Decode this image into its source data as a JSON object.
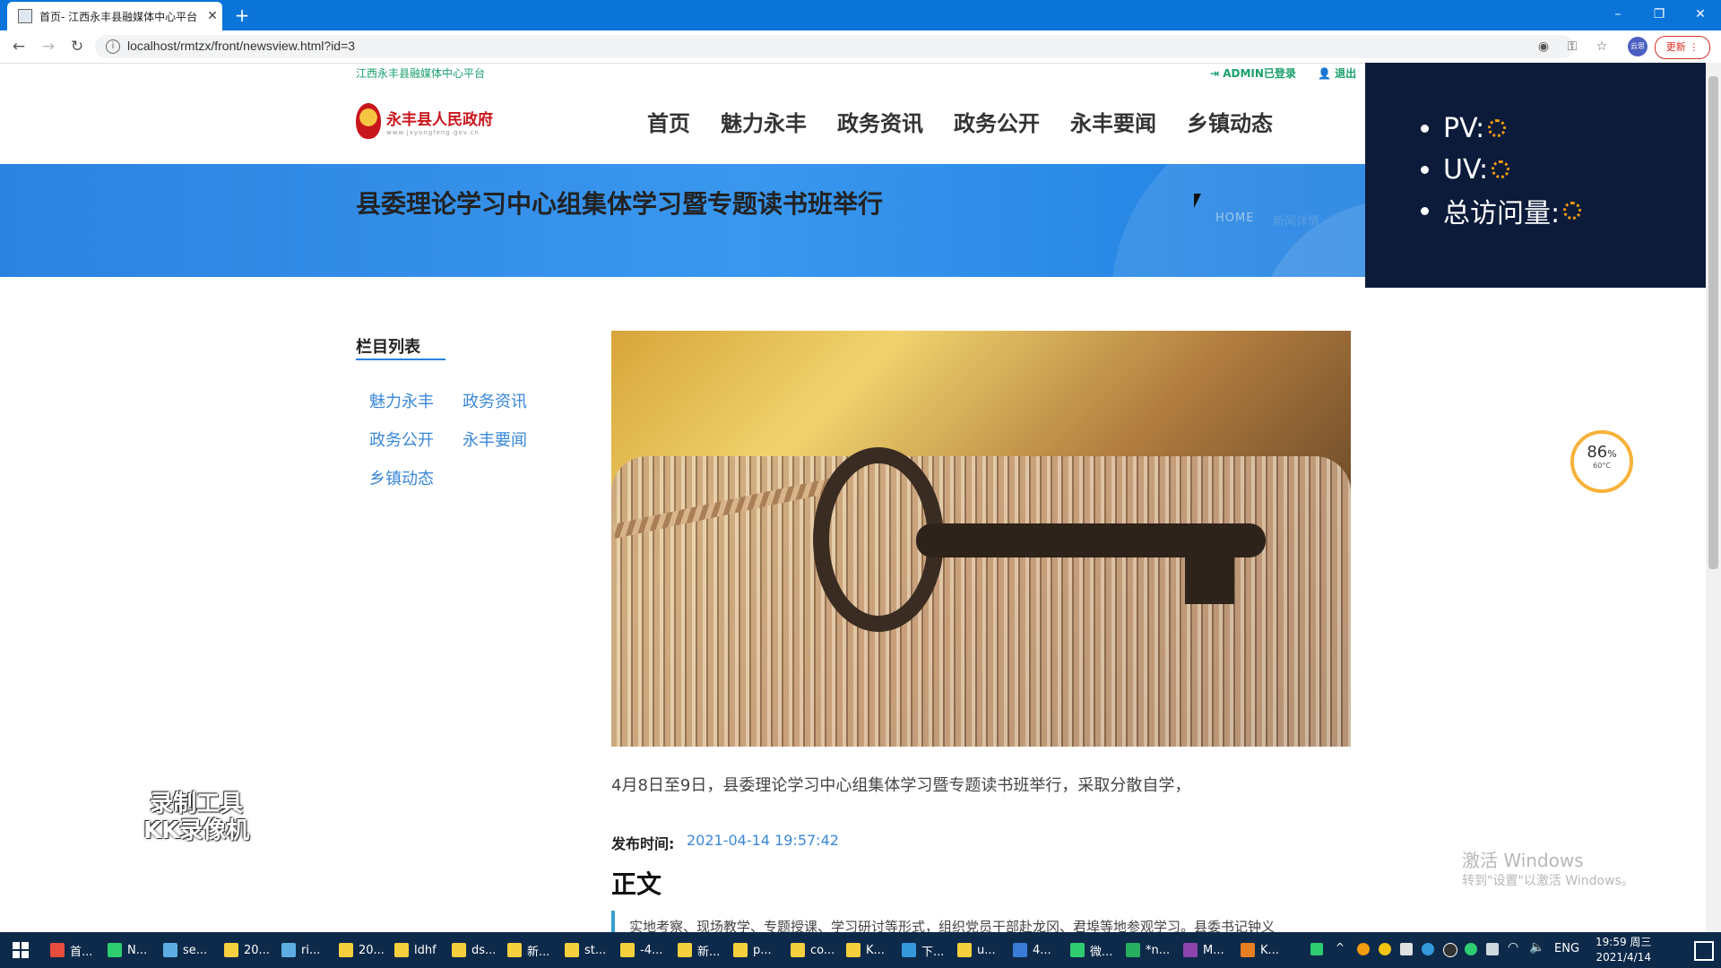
{
  "browser": {
    "tab_title": "首页- 江西永丰县融媒体中心平台",
    "url": "localhost/rmtzx/front/newsview.html?id=3",
    "update_label": "更新",
    "profile_label": "云思"
  },
  "site": {
    "top_name": "江西永丰县融媒体中心平台",
    "login_status": "ADMIN已登录",
    "logout": "退出",
    "logo_text": "永丰县人民政府",
    "logo_sub": "www.jxyongfeng.gov.cn",
    "nav": [
      "首页",
      "魅力永丰",
      "政务资讯",
      "政务公开",
      "永丰要闻",
      "乡镇动态"
    ]
  },
  "banner": {
    "title": "县委理论学习中心组集体学习暨专题读书班举行",
    "crumb_home": "HOME",
    "crumb_current": "新闻详情"
  },
  "stats": {
    "pv_label": "PV:",
    "uv_label": "UV:",
    "total_label": "总访问量:"
  },
  "sidebar": {
    "title": "栏目列表",
    "links": [
      "魅力永丰",
      "政务资讯",
      "政务公开",
      "永丰要闻",
      "乡镇动态"
    ]
  },
  "article": {
    "excerpt": "4月8日至9日，县委理论学习中心组集体学习暨专题读书班举行，采取分散自学，",
    "date_label": "发布时间:",
    "date_value": "2021-04-14 19:57:42",
    "heading": "正文",
    "body": "实地考察、现场教学、专题授课、学习研讨等形式，组织党员干部赴龙冈、君埠等地参观学习。县委书记钟义"
  },
  "overlay": {
    "gauge_percent": "86",
    "gauge_percent_sign": "%",
    "gauge_temp": "60°C",
    "watermark_line1": "录制工具",
    "watermark_line2": "KK录像机",
    "activate_title": "激活 Windows",
    "activate_sub": "转到\"设置\"以激活 Windows。"
  },
  "taskbar": {
    "items": [
      "首...",
      "N...",
      "se...",
      "20...",
      "ri...",
      "20...",
      "ldhf",
      "ds...",
      "新...",
      "st...",
      "-4...",
      "新...",
      "p...",
      "co...",
      "K...",
      "下...",
      "u...",
      "4...",
      "微...",
      "*n...",
      "M...",
      "K..."
    ],
    "ime": "ENG",
    "time": "19:59 周三",
    "date": "2021/4/14"
  },
  "colors": {
    "chrome_blue": "#0a74d8",
    "accent_green": "#18a06a",
    "banner_blue": "#2a83e0",
    "stats_bg": "#0c1b3a",
    "link_blue": "#3a87d8"
  }
}
